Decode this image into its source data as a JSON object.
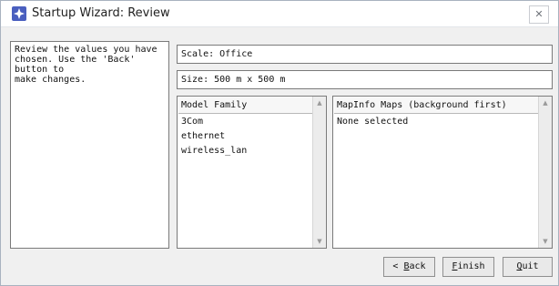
{
  "window": {
    "title": "Startup Wizard: Review",
    "close_glyph": "✕",
    "app_icon": "wizard-star-icon"
  },
  "info": {
    "text": "Review the values you have\nchosen. Use the 'Back' button to\nmake changes."
  },
  "fields": {
    "scale": "Scale: Office",
    "size": "Size: 500 m x 500 m"
  },
  "model_family": {
    "header": "Model Family",
    "items": [
      "3Com",
      "ethernet",
      "wireless_lan"
    ]
  },
  "maps": {
    "header": "MapInfo Maps (background first)",
    "items": [
      "None selected"
    ]
  },
  "buttons": {
    "back_arrow": "<",
    "back_key": "B",
    "back_rest": "ack",
    "finish_key": "F",
    "finish_rest": "inish",
    "quit_key": "Q",
    "quit_rest": "uit"
  }
}
